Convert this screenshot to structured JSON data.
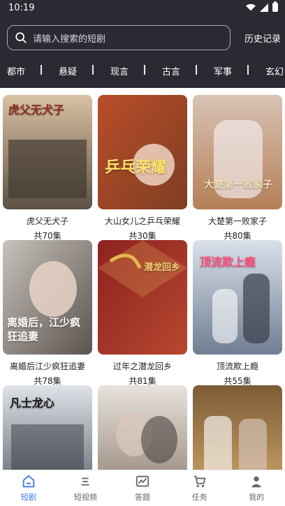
{
  "status": {
    "time": "10:19"
  },
  "search": {
    "placeholder": "请输入搜索的短剧",
    "history_label": "历史记录"
  },
  "categories": [
    "都市",
    "悬疑",
    "现言",
    "古言",
    "军事",
    "玄幻"
  ],
  "dramas": [
    {
      "title": "虎父无犬子",
      "count": "共70集",
      "poster_text": "虎父无犬子",
      "colors": [
        "#d9c2a3",
        "#5d5145"
      ]
    },
    {
      "title": "大山女儿之乒乓荣耀",
      "count": "共30集",
      "poster_text": "乒乓荣耀",
      "colors": [
        "#b94d2a",
        "#7e3e21"
      ]
    },
    {
      "title": "大楚第一败家子",
      "count": "共80集",
      "poster_text": "大楚第一败家子",
      "colors": [
        "#d8c3b4",
        "#b57f58"
      ]
    },
    {
      "title": "离婚后江少疯狂追妻",
      "count": "共78集",
      "poster_text": "离婚后，江少疯狂追妻",
      "colors": [
        "#c7c2bd",
        "#5c534e"
      ]
    },
    {
      "title": "过年之潜龙回乡",
      "count": "共81集",
      "poster_text": "潜龙回乡",
      "colors": [
        "#8d221f",
        "#b7472f"
      ]
    },
    {
      "title": "顶流欺上瘾",
      "count": "共55集",
      "poster_text": "顶流欺上瘾",
      "colors": [
        "#dae1eb",
        "#6f7e93"
      ]
    },
    {
      "title": "",
      "count": "",
      "poster_text": "凡士龙心",
      "colors": [
        "#dfe3e8",
        "#58606b"
      ]
    },
    {
      "title": "",
      "count": "",
      "poster_text": "",
      "colors": [
        "#e8e3dc",
        "#8e7f72"
      ]
    },
    {
      "title": "",
      "count": "",
      "poster_text": "",
      "colors": [
        "#7d5b36",
        "#d1a96a"
      ]
    }
  ],
  "tabs": [
    {
      "label": "短剧",
      "icon": "home-icon",
      "active": true
    },
    {
      "label": "短视频",
      "icon": "list-icon",
      "active": false
    },
    {
      "label": "答题",
      "icon": "chart-icon",
      "active": false
    },
    {
      "label": "任务",
      "icon": "cart-icon",
      "active": false
    },
    {
      "label": "我的",
      "icon": "profile-icon",
      "active": false
    }
  ],
  "colors": {
    "header_bg": "#2a2a33",
    "active_tab": "#3a78e8"
  }
}
